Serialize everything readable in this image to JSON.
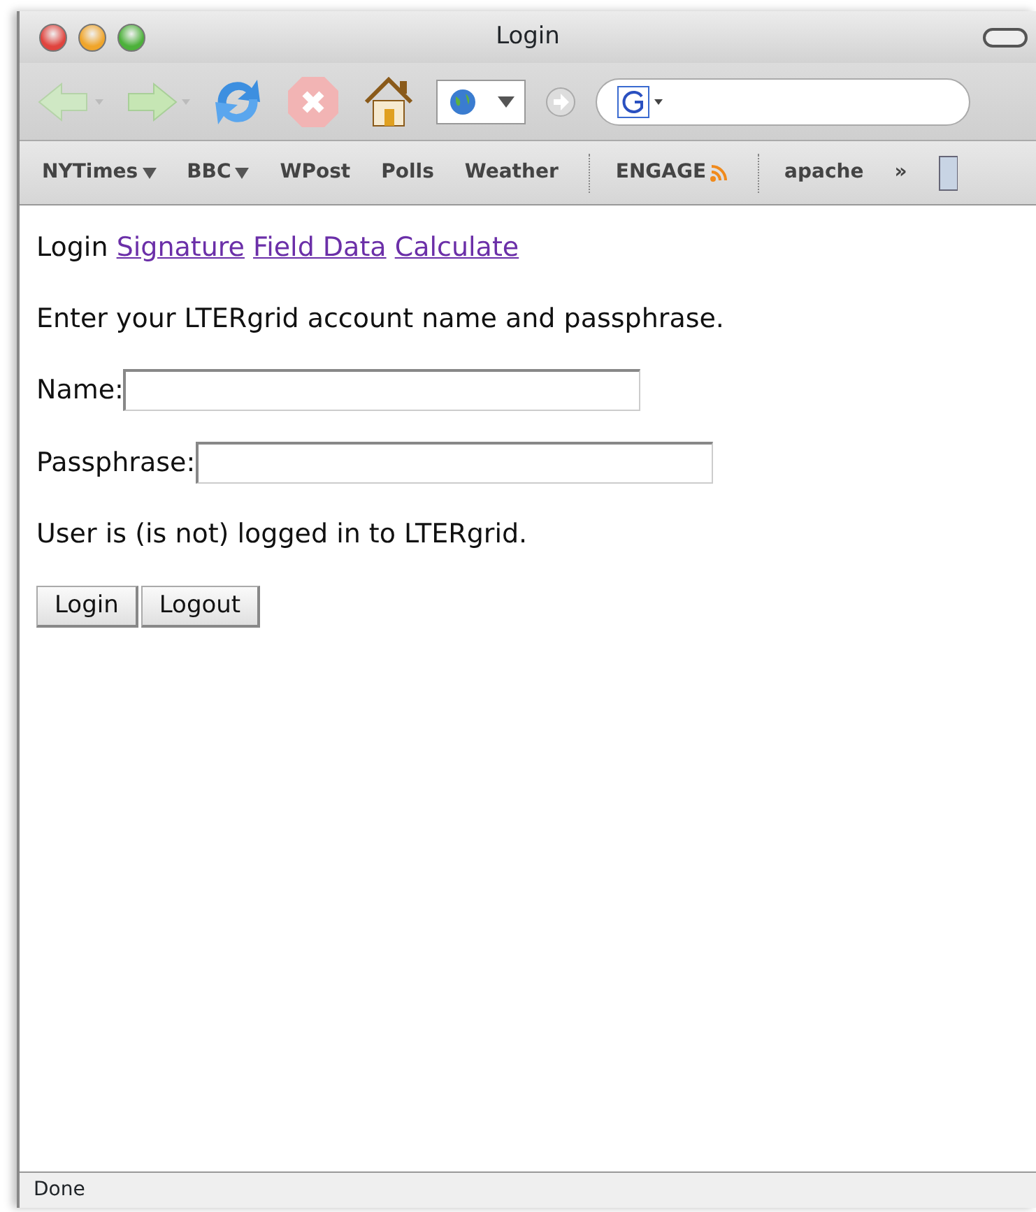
{
  "window": {
    "title": "Login"
  },
  "bookmarks": [
    {
      "kind": "link",
      "label": "NYTimes",
      "menu": true,
      "feed": false
    },
    {
      "kind": "link",
      "label": "BBC",
      "menu": true,
      "feed": false
    },
    {
      "kind": "link",
      "label": "WPost",
      "menu": false,
      "feed": false
    },
    {
      "kind": "link",
      "label": "Polls",
      "menu": false,
      "feed": false
    },
    {
      "kind": "link",
      "label": "Weather",
      "menu": false,
      "feed": false
    },
    {
      "kind": "separator"
    },
    {
      "kind": "link",
      "label": "ENGAGE",
      "menu": false,
      "feed": true
    },
    {
      "kind": "separator"
    },
    {
      "kind": "link",
      "label": "apache",
      "menu": false,
      "feed": false
    }
  ],
  "bookmarks_overflow": "»",
  "page": {
    "nav": [
      {
        "label": "Login",
        "kind": "current"
      },
      {
        "label": "Signature",
        "kind": "link"
      },
      {
        "label": "Field Data",
        "kind": "link"
      },
      {
        "label": "Calculate",
        "kind": "link"
      }
    ],
    "intro": "Enter your LTERgrid account name and passphrase.",
    "fields": [
      {
        "label": "Name:"
      },
      {
        "label": "Passphrase:"
      }
    ],
    "status": "User is (is not) logged in to LTERgrid.",
    "buttons": [
      "Login",
      "Logout"
    ]
  },
  "status_bar": "Done"
}
